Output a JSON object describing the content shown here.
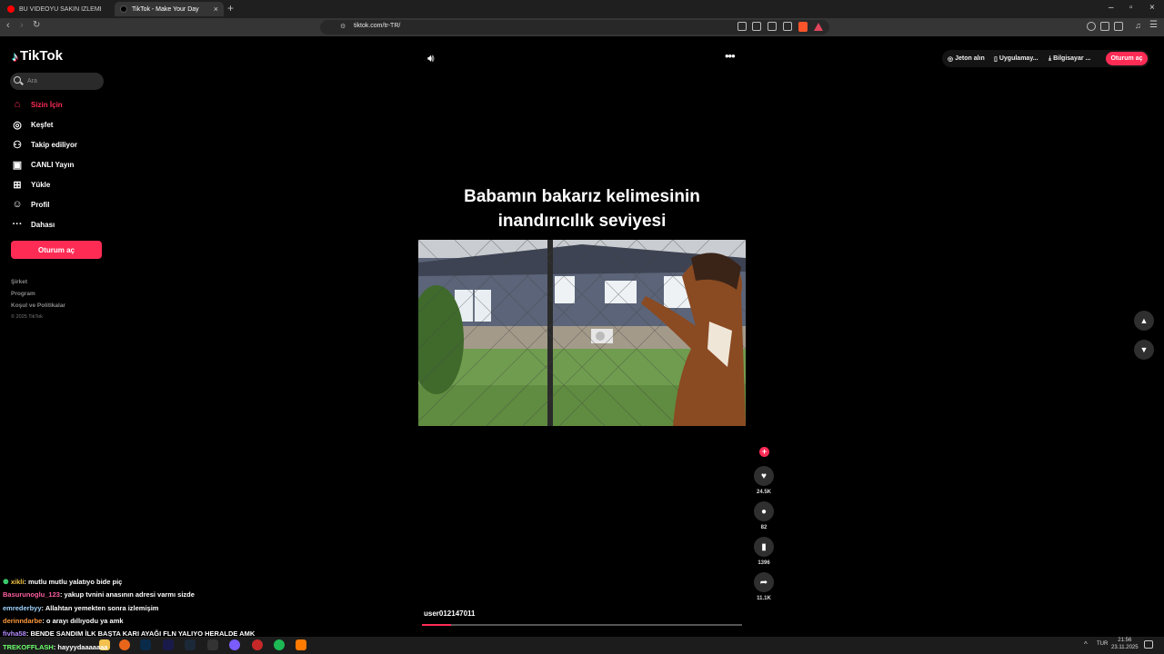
{
  "browser": {
    "tabs": [
      {
        "title": "BU VİDEOYU SAKIN İZLEMEYİN (kuzi"
      },
      {
        "title": "TikTok - Make Your Day"
      }
    ],
    "url": "tiktok.com/tr-TR/"
  },
  "brand": {
    "name": "TikTok",
    "accent": "#fe2c55"
  },
  "search": {
    "placeholder": "Ara"
  },
  "sidebar": {
    "items": [
      {
        "label": "Sizin İçin",
        "icon": "home-icon",
        "active": true
      },
      {
        "label": "Keşfet",
        "icon": "compass-icon"
      },
      {
        "label": "Takip ediliyor",
        "icon": "following-icon"
      },
      {
        "label": "CANLI Yayın",
        "icon": "live-icon"
      },
      {
        "label": "Yükle",
        "icon": "upload-icon"
      },
      {
        "label": "Profil",
        "icon": "profile-icon"
      },
      {
        "label": "Dahası",
        "icon": "more-dots-icon"
      }
    ],
    "login_label": "Oturum aç",
    "footer_links": [
      "Şirket",
      "Program",
      "Koşul ve Politikalar"
    ],
    "copyright": "© 2025 TikTok"
  },
  "header": {
    "coins_label": "Jeton alın",
    "app_label": "Uygulamay...",
    "pc_label": "Bilgisayar ...",
    "login_label": "Oturum aç"
  },
  "video": {
    "caption_line1": "Babamın bakarız kelimesinin",
    "caption_line2": "inandırıcılık seviyesi",
    "username": "user012147011",
    "progress": 0.09,
    "likes": "24.5K",
    "comments": "82",
    "saves": "1396",
    "shares": "11.1K"
  },
  "chat": [
    {
      "user": "xikli",
      "text": ": mutlu mutlu yalatıyo bide piç",
      "color": "#f5c542"
    },
    {
      "user": "Basurunoglu_123",
      "text": ": yakup tvnini anasının adresi varmı sizde",
      "color": "#ff5fa2"
    },
    {
      "user": "emrederbyy",
      "text": ": Allahtan yemekten sonra izlemişim",
      "color": "#9fd3ff"
    },
    {
      "user": "derinndarbe",
      "text": ": o arayı dıllıyodu ya amk",
      "color": "#ff9a3c"
    },
    {
      "user": "fivha58",
      "text": ": BENDE SANDIM İLK BAŞTA KARI AYAĞI FLN YALIYO HERALDE AMK",
      "color": "#b48cff"
    },
    {
      "user": "TREKOFFLASH",
      "text": ": hayyydaaaaaaa",
      "color": "#6cff6c"
    }
  ],
  "taskbar": {
    "lang": "TUR",
    "time": "21:56",
    "date": "23.11.2025"
  }
}
